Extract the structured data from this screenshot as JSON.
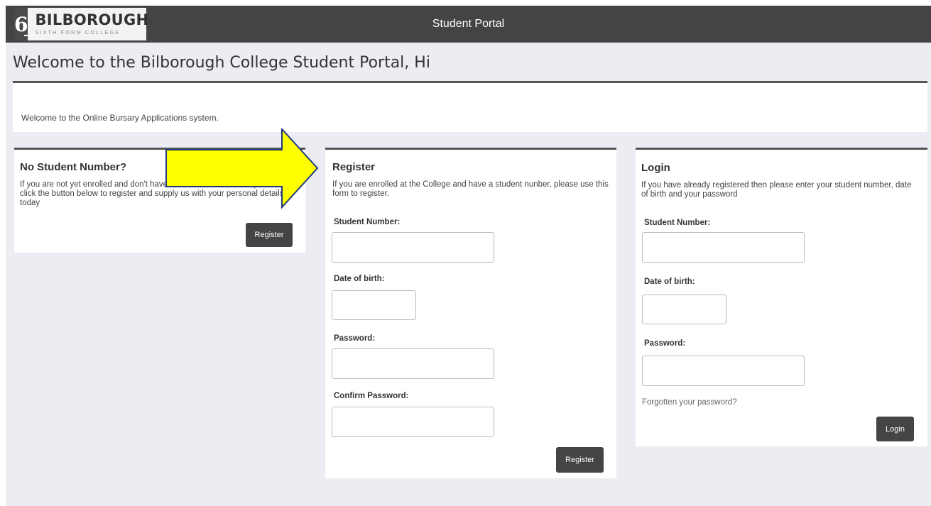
{
  "header": {
    "logo_name": "BILBOROUGH",
    "logo_sub": "SIXTH FORM COLLEGE",
    "title": "Student Portal"
  },
  "page": {
    "title": "Welcome to the Bilborough College Student Portal, Hi",
    "welcome": "Welcome to the Online Bursary Applications system."
  },
  "no_number": {
    "heading": "No Student Number?",
    "description": "If you are not yet enrolled and don't have a student number then please click the button below to register and supply us with your personal details today",
    "button": "Register"
  },
  "register": {
    "heading": "Register",
    "description": "If you are enrolled at the College and have a student nunber, please use this form to register.",
    "student_number_label": "Student Number:",
    "dob_label": "Date of birth:",
    "password_label": "Password:",
    "confirm_label": "Confirm Password:",
    "student_number_value": "",
    "dob_value": "",
    "password_value": "",
    "confirm_value": "",
    "button": "Register"
  },
  "login": {
    "heading": "Login",
    "description": "If you have already registered then please enter your student number, date of birth and your password",
    "student_number_label": "Student Number:",
    "dob_label": "Date of birth:",
    "password_label": "Password:",
    "student_number_value": "",
    "dob_value": "",
    "password_value": "",
    "forgot_link": "Forgotten your password?",
    "button": "Login"
  },
  "colors": {
    "topbar": "#444444",
    "background": "#ebedf2",
    "button": "#444444",
    "arrow_fill": "#ffff00",
    "arrow_stroke": "#1f3b7a"
  },
  "icons": {
    "logo": "logo-6-icon",
    "annotation": "arrow-right-icon"
  }
}
